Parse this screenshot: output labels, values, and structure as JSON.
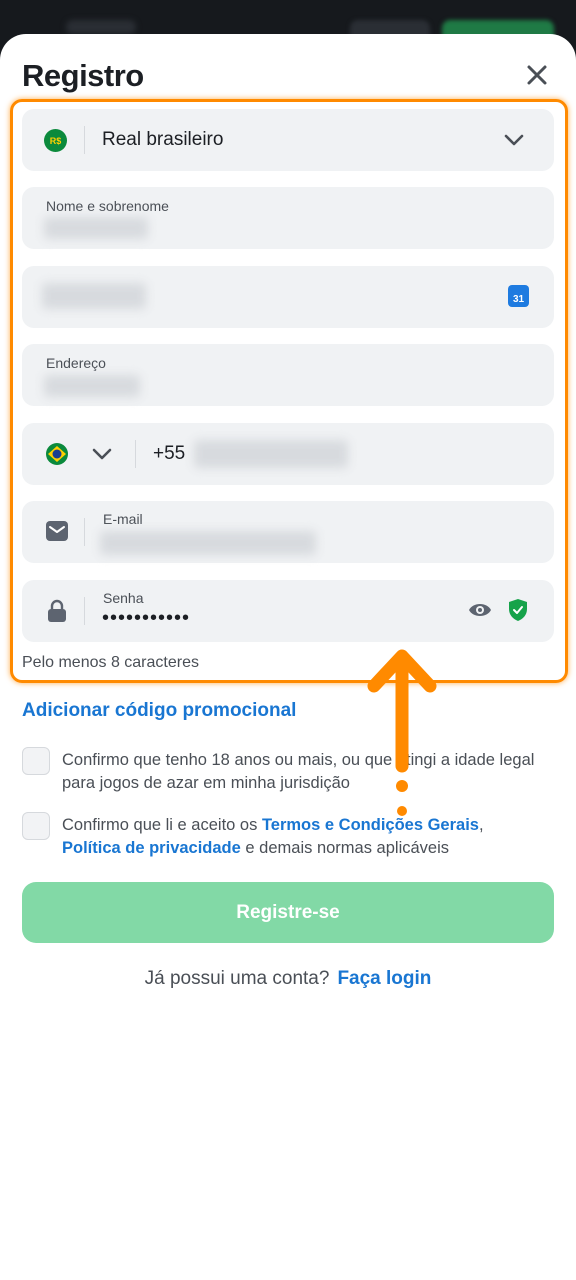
{
  "header": {
    "title": "Registro"
  },
  "currency": {
    "badge": "R$",
    "value": "Real brasileiro"
  },
  "name_field": {
    "label": "Nome e sobrenome"
  },
  "birthdate_field": {
    "calendar_day": "31"
  },
  "address_field": {
    "label": "Endereço"
  },
  "phone_field": {
    "prefix": "+55"
  },
  "email_field": {
    "label": "E-mail"
  },
  "password_field": {
    "label": "Senha",
    "value": "•••••••••••"
  },
  "password_hint": "Pelo menos 8 caracteres",
  "promo_link": "Adicionar código promocional",
  "consent_age": {
    "text": "Confirmo que tenho 18 anos ou mais, ou que atingi a idade legal para jogos de azar em minha jurisdição"
  },
  "consent_terms": {
    "text_before": "Confirmo que li e aceito os ",
    "terms_link": "Termos e Condições Gerais",
    "comma": ",",
    "privacy_link": "Política de privacidade",
    "text_after": " e demais normas aplicáveis"
  },
  "submit_button": "Registre-se",
  "login_prompt": {
    "text": "Já possui uma conta?",
    "link": "Faça login"
  },
  "colors": {
    "accent": "#1976d2",
    "highlight": "#ff8a00",
    "submit": "#82d9a6",
    "shield": "#16a34a"
  }
}
